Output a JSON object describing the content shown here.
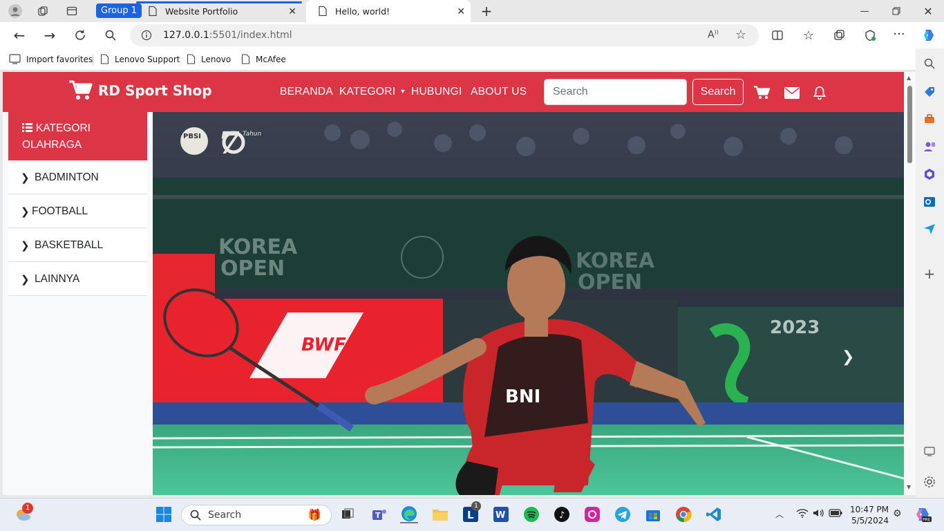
{
  "browser": {
    "group_label": "Group 1",
    "tabs": [
      {
        "title": "Website Portfolio",
        "active": false
      },
      {
        "title": "Hello, world!",
        "active": true
      }
    ],
    "url_host": "127.0.0.1",
    "url_path": ":5501/index.html",
    "favorites": [
      "Import favorites",
      "Lenovo Support",
      "Lenovo",
      "McAfee"
    ]
  },
  "site": {
    "brand": "RD Sport Shop",
    "nav": [
      "BERANDA",
      "KATEGORI",
      "HUBUNGI",
      "ABOUT US"
    ],
    "search_placeholder": "Search",
    "search_button": "Search",
    "sidebar_title": "KATEGORI OLAHRAGA",
    "categories": [
      "BADMINTON",
      "FOOTBALL",
      "BASKETBALL",
      "LAINNYA"
    ],
    "accent": "#dc3545",
    "hero_text": {
      "logo_badge": "PBSI",
      "anniversary": "Tahun",
      "board_brand": "BWF",
      "korea_line1": "KOREA",
      "korea_line2": "OPEN",
      "year": "2023",
      "jersey": "BNI"
    }
  },
  "taskbar": {
    "search_label": "Search",
    "time": "10:47 PM",
    "date": "5/5/2024",
    "badge_count": "1",
    "teams_badge": "1"
  }
}
